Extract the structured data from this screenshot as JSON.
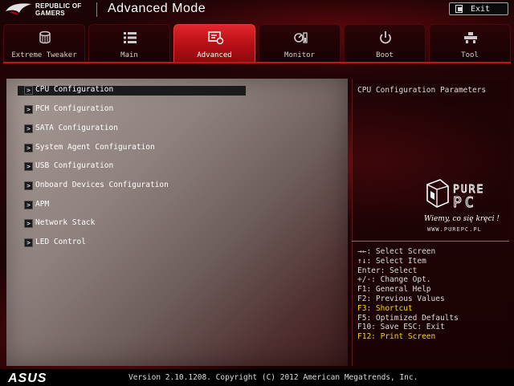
{
  "header": {
    "brand_line1": "REPUBLIC OF",
    "brand_line2": "GAMERS",
    "title": "Advanced Mode",
    "exit_label": "Exit"
  },
  "tabs": [
    {
      "label": "Extreme Tweaker",
      "icon": "tweaker-icon",
      "active": false
    },
    {
      "label": "Main",
      "icon": "list-icon",
      "active": false
    },
    {
      "label": "Advanced",
      "icon": "advanced-icon",
      "active": true
    },
    {
      "label": "Monitor",
      "icon": "monitor-icon",
      "active": false
    },
    {
      "label": "Boot",
      "icon": "power-icon",
      "active": false
    },
    {
      "label": "Tool",
      "icon": "tool-icon",
      "active": false
    }
  ],
  "menu": {
    "items": [
      {
        "label": "CPU Configuration",
        "selected": true
      },
      {
        "label": "PCH Configuration",
        "selected": false
      },
      {
        "label": "SATA Configuration",
        "selected": false
      },
      {
        "label": "System Agent Configuration",
        "selected": false
      },
      {
        "label": "USB Configuration",
        "selected": false
      },
      {
        "label": "Onboard Devices Configuration",
        "selected": false
      },
      {
        "label": "APM",
        "selected": false
      },
      {
        "label": "Network Stack",
        "selected": false
      },
      {
        "label": "LED Control",
        "selected": false
      }
    ],
    "arrow_glyph": ">"
  },
  "help": {
    "title": "CPU Configuration Parameters"
  },
  "watermark": {
    "brand_top": "PURE",
    "brand_bottom": "PC",
    "slogan": "Wiemy, co się kręci !",
    "url": "WWW.PUREPC.PL"
  },
  "keys": [
    {
      "text": "→←: Select Screen",
      "highlight": false
    },
    {
      "text": "↑↓: Select Item",
      "highlight": false
    },
    {
      "text": "Enter: Select",
      "highlight": false
    },
    {
      "text": "+/-: Change Opt.",
      "highlight": false
    },
    {
      "text": "F1: General Help",
      "highlight": false
    },
    {
      "text": "F2: Previous Values",
      "highlight": false
    },
    {
      "text": "F3: Shortcut",
      "highlight": true
    },
    {
      "text": "F5: Optimized Defaults",
      "highlight": false
    },
    {
      "text": "F10: Save  ESC: Exit",
      "highlight": false
    },
    {
      "text": "F12: Print Screen",
      "highlight": true
    }
  ],
  "footer": {
    "brand": "ASUS",
    "version": "Version 2.10.1208. Copyright (C) 2012 American Megatrends, Inc."
  },
  "colors": {
    "accent_red": "#c3141a",
    "highlight_yellow": "#f5d90a"
  }
}
